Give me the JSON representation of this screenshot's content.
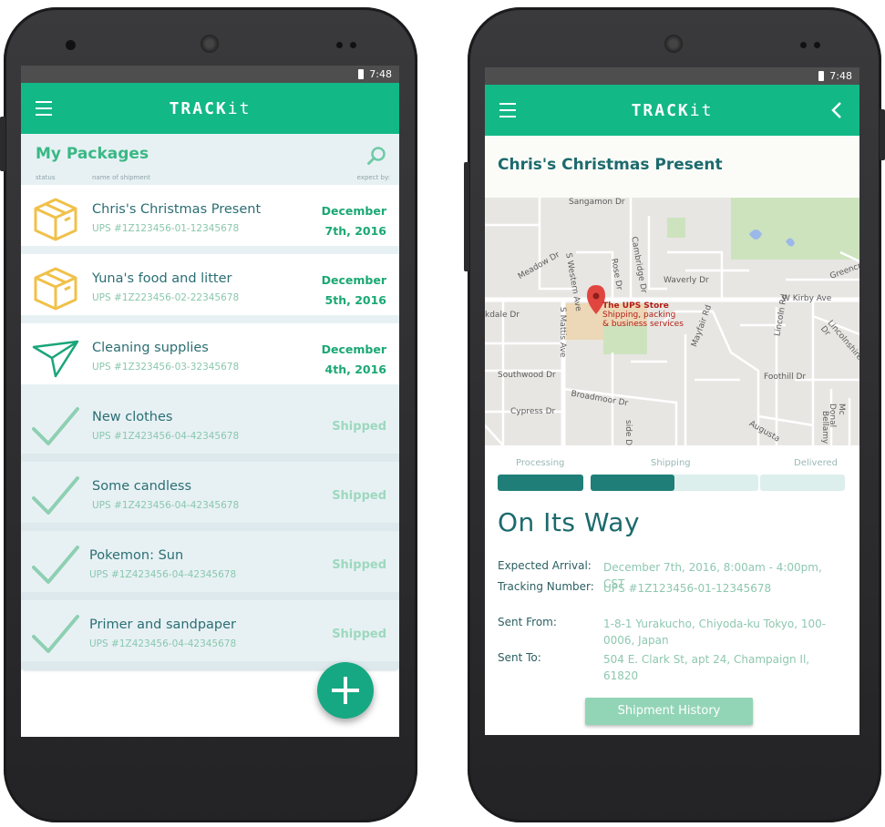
{
  "colors": {
    "accent": "#13b887",
    "dark_teal": "#1c6a6c",
    "light_green": "#8ec7b0",
    "box_yellow": "#f0c14b"
  },
  "left_phone": {
    "status_time": "7:48",
    "app_title_main": "TRACK",
    "app_title_suffix": "it",
    "list_title": "My Packages",
    "col_status": "status",
    "col_name": "name of shipment",
    "col_expect": "expect by:",
    "packages": [
      {
        "icon": "box-icon",
        "name": "Chris's Christmas Present",
        "tracking": "UPS #1Z123456-01-12345678",
        "due_line1": "December",
        "due_line2": "7th, 2016"
      },
      {
        "icon": "box-icon",
        "name": "Yuna's food and litter",
        "tracking": "UPS #1Z223456-02-22345678",
        "due_line1": "December",
        "due_line2": "5th, 2016"
      },
      {
        "icon": "paper-plane-icon",
        "name": "Cleaning supplies",
        "tracking": "UPS #1Z323456-03-32345678",
        "due_line1": "December",
        "due_line2": "4th, 2016"
      },
      {
        "icon": "check-icon",
        "name": "New clothes",
        "tracking": "UPS #1Z423456-04-42345678",
        "status": "Shipped"
      },
      {
        "icon": "check-icon",
        "name": "Some candless",
        "tracking": "UPS #1Z423456-04-42345678",
        "status": "Shipped"
      },
      {
        "icon": "check-icon",
        "name": "Pokemon: Sun",
        "tracking": "UPS #1Z423456-04-42345678",
        "status": "Shipped"
      },
      {
        "icon": "check-icon",
        "name": "Primer and sandpaper",
        "tracking": "UPS #1Z423456-04-42345678",
        "status": "Shipped"
      }
    ]
  },
  "right_phone": {
    "status_time": "7:48",
    "app_title_main": "TRACK",
    "app_title_suffix": "it",
    "package_title": "Chris's Christmas Present",
    "map": {
      "streets": [
        "Sangamon Dr",
        "Meadow Dr",
        "S Western Ave",
        "Cambridge Dr",
        "Rose Dr",
        "Waverly Dr",
        "Greencr",
        "W Kirby Ave",
        "kdale Dr",
        "S Mattis Ave",
        "Mayfair Rd",
        "Lincoln Rd",
        "Lincolnshire Dr",
        "Southwood Dr",
        "Foothill Dr",
        "Broadmoor Dr",
        "Cypress Dr",
        "Mc Donal",
        "Bellamy",
        "Augusta",
        "side D"
      ],
      "place_name": "The UPS Store",
      "place_desc_1": "Shipping, packing",
      "place_desc_2": "& business services"
    },
    "steps": [
      "Processing",
      "Shipping",
      "Delivered"
    ],
    "progress_fraction": 0.5,
    "status_heading": "On Its Way",
    "labels": {
      "arrival": "Expected Arrival:",
      "tracking": "Tracking Number:",
      "from": "Sent From:",
      "to": "Sent To:"
    },
    "values": {
      "arrival": "December 7th, 2016, 8:00am - 4:00pm, CST",
      "tracking": "UPS #1Z123456-01-12345678",
      "from": "1-8-1 Yurakucho, Chiyoda-ku Tokyo, 100-0006, Japan",
      "to": "504 E. Clark St, apt 24, Champaign Il, 61820"
    },
    "history_button": "Shipment History"
  }
}
